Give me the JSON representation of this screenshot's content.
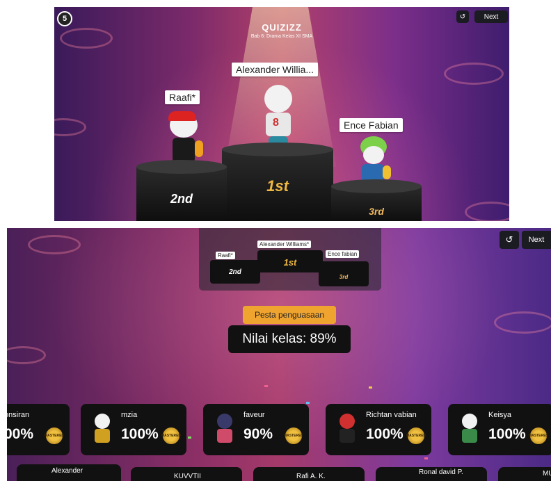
{
  "top": {
    "round": "5",
    "logo": "QUIZIZZ",
    "subtitle": "Bab 6: Drama Kelas XI SMA",
    "next_label": "Next",
    "undo_icon": "↺",
    "podium": [
      {
        "name": "Alexander Willia...",
        "rank": "1st"
      },
      {
        "name": "Raafi*",
        "rank": "2nd"
      },
      {
        "name": "Ence Fabian",
        "rank": "3rd"
      }
    ]
  },
  "bottom": {
    "next_label": "Next",
    "undo_icon": "↺",
    "mini_podium": [
      {
        "name": "Alexander Williams*",
        "rank": "1st"
      },
      {
        "name": "Raafi*",
        "rank": "2nd"
      },
      {
        "name": "Ence fabian",
        "rank": "3rd"
      }
    ],
    "mastery_badge": "Pesta penguasaan",
    "class_score": "Nilai kelas: 89%",
    "mastered_seal": "MASTERED",
    "cards": [
      {
        "name": "onsiran",
        "pct": "00%"
      },
      {
        "name": "mzia",
        "pct": "100%"
      },
      {
        "name": "faveur",
        "pct": "90%"
      },
      {
        "name": "Richtan vabian",
        "pct": "100%"
      },
      {
        "name": "Keisya",
        "pct": "100%"
      }
    ],
    "cards_row2": [
      {
        "name": "Alexander"
      },
      {
        "name": "KUVVTII"
      },
      {
        "name": "Rafi A. K."
      },
      {
        "name": "Ronal david P."
      },
      {
        "name": "MU"
      }
    ]
  }
}
